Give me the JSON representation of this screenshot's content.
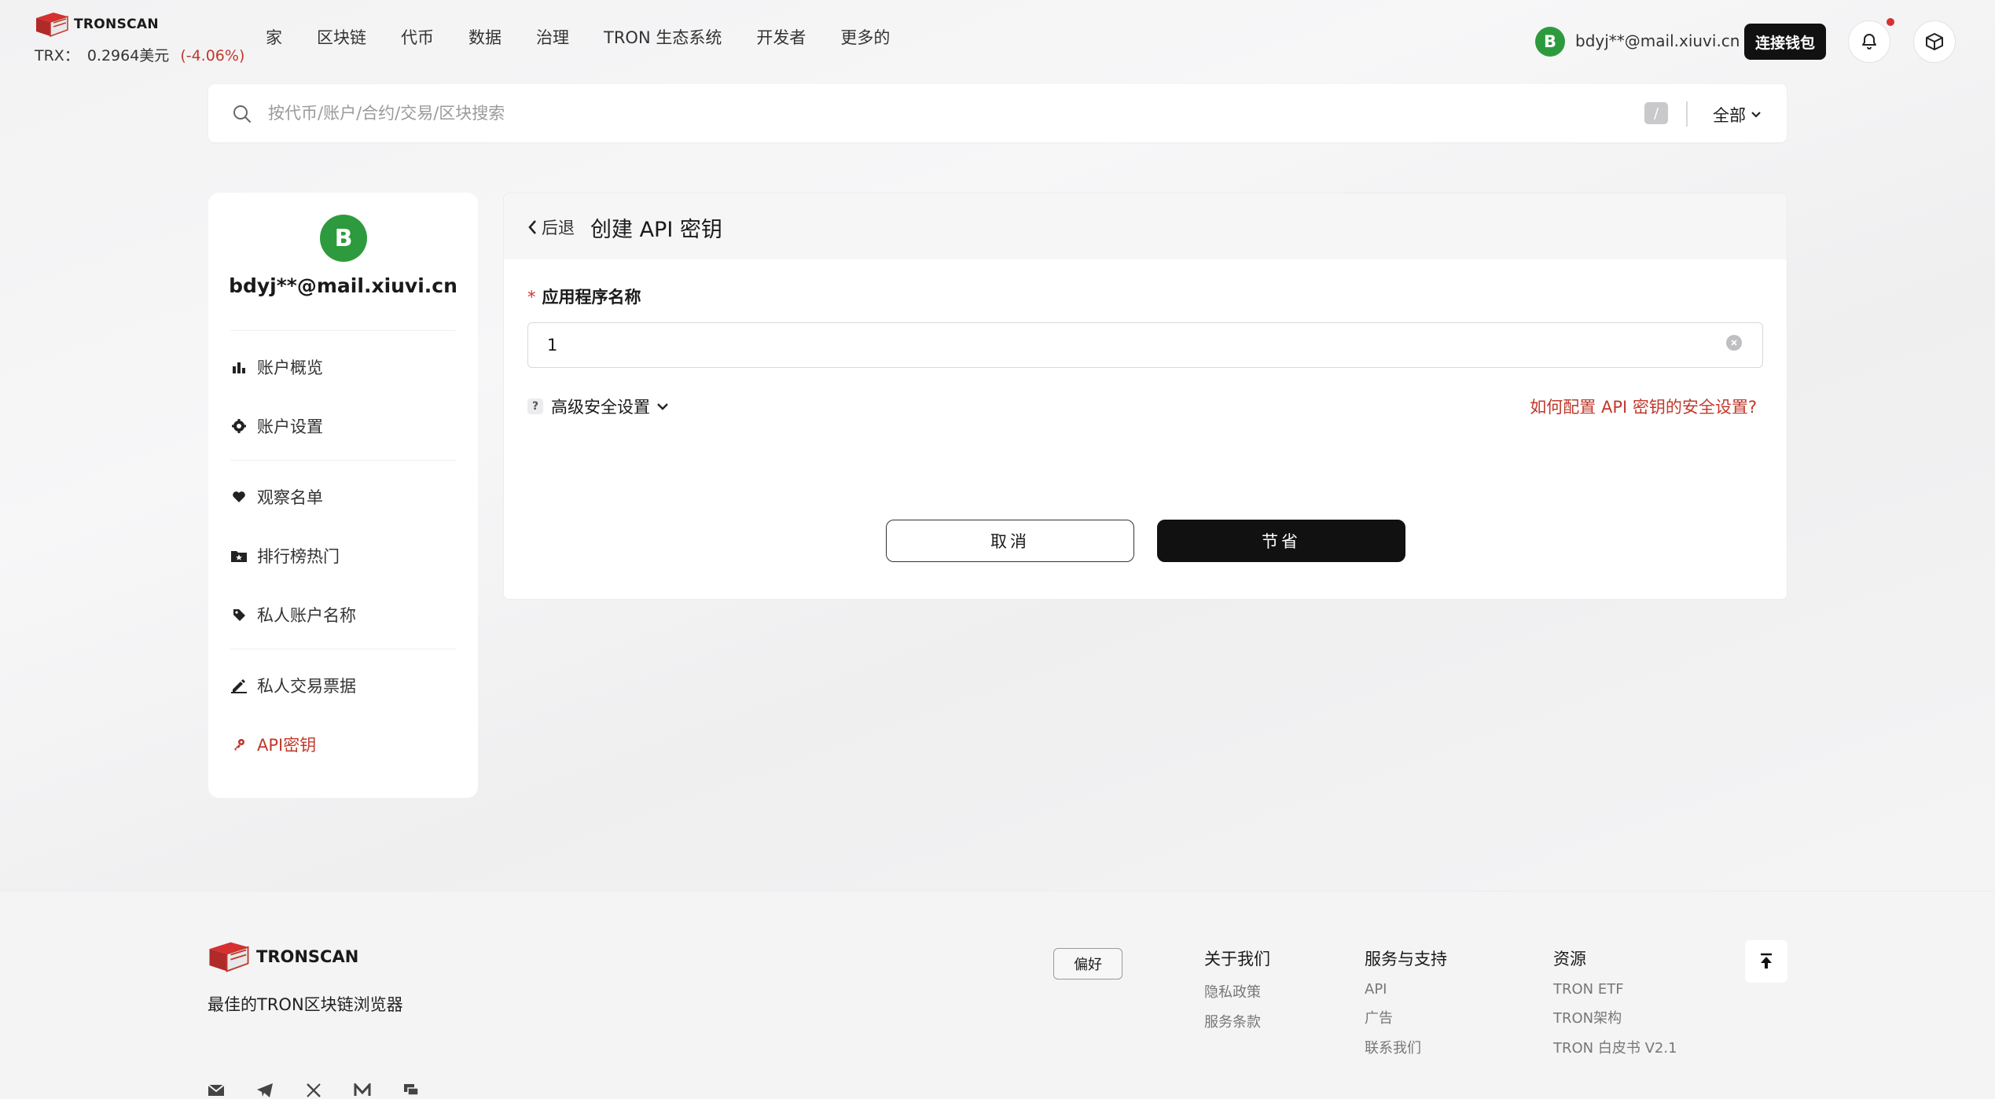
{
  "header": {
    "brand": "TRONSCAN",
    "price": {
      "label": "TRX：",
      "value": "0.2964美元",
      "change": "(-4.06%)"
    },
    "nav": [
      "家",
      "区块链",
      "代币",
      "数据",
      "治理",
      "TRON 生态系统",
      "开发者",
      "更多的"
    ],
    "user": {
      "avatar_letter": "B",
      "email": "bdyj**@mail.xiuvi.cn"
    },
    "connect_wallet": "连接钱包"
  },
  "search": {
    "placeholder": "按代币/账户/合约/交易/区块搜索",
    "shortcut": "/",
    "scope": "全部"
  },
  "sidebar": {
    "avatar_letter": "B",
    "email": "bdyj**@mail.xiuvi.cn",
    "items": [
      {
        "label": "账户概览",
        "icon": "bar-chart-icon"
      },
      {
        "label": "账户设置",
        "icon": "gear-icon"
      },
      {
        "label": "观察名单",
        "icon": "heart-icon"
      },
      {
        "label": "排行榜热门",
        "icon": "folder-star-icon"
      },
      {
        "label": "私人账户名称",
        "icon": "tag-icon"
      },
      {
        "label": "私人交易票据",
        "icon": "pencil-icon"
      },
      {
        "label": "API密钥",
        "icon": "key-icon"
      }
    ]
  },
  "panel": {
    "back": "后退",
    "title": "创建 API 密钥",
    "field_required": "*",
    "field_label": "应用程序名称",
    "field_value": "1",
    "advanced": "高级安全设置",
    "help_badge": "?",
    "how_link": "如何配置 API 密钥的安全设置?",
    "cancel": "取消",
    "save": "节省"
  },
  "footer": {
    "brand": "TRONSCAN",
    "slogan": "最佳的TRON区块链浏览器",
    "preferences": "偏好",
    "columns": [
      {
        "title": "关于我们",
        "links": [
          "隐私政策",
          "服务条款"
        ]
      },
      {
        "title": "服务与支持",
        "links": [
          "API",
          "广告",
          "联系我们"
        ]
      },
      {
        "title": "资源",
        "links": [
          "TRON ETF",
          "TRON架构",
          "TRON 白皮书 V2.1"
        ]
      }
    ],
    "social": [
      "mail-icon",
      "telegram-icon",
      "x-icon",
      "medium-icon",
      "forum-icon"
    ]
  },
  "colors": {
    "accent": "#c0392b",
    "avatar": "#2e9a3e",
    "dark": "#111111"
  }
}
